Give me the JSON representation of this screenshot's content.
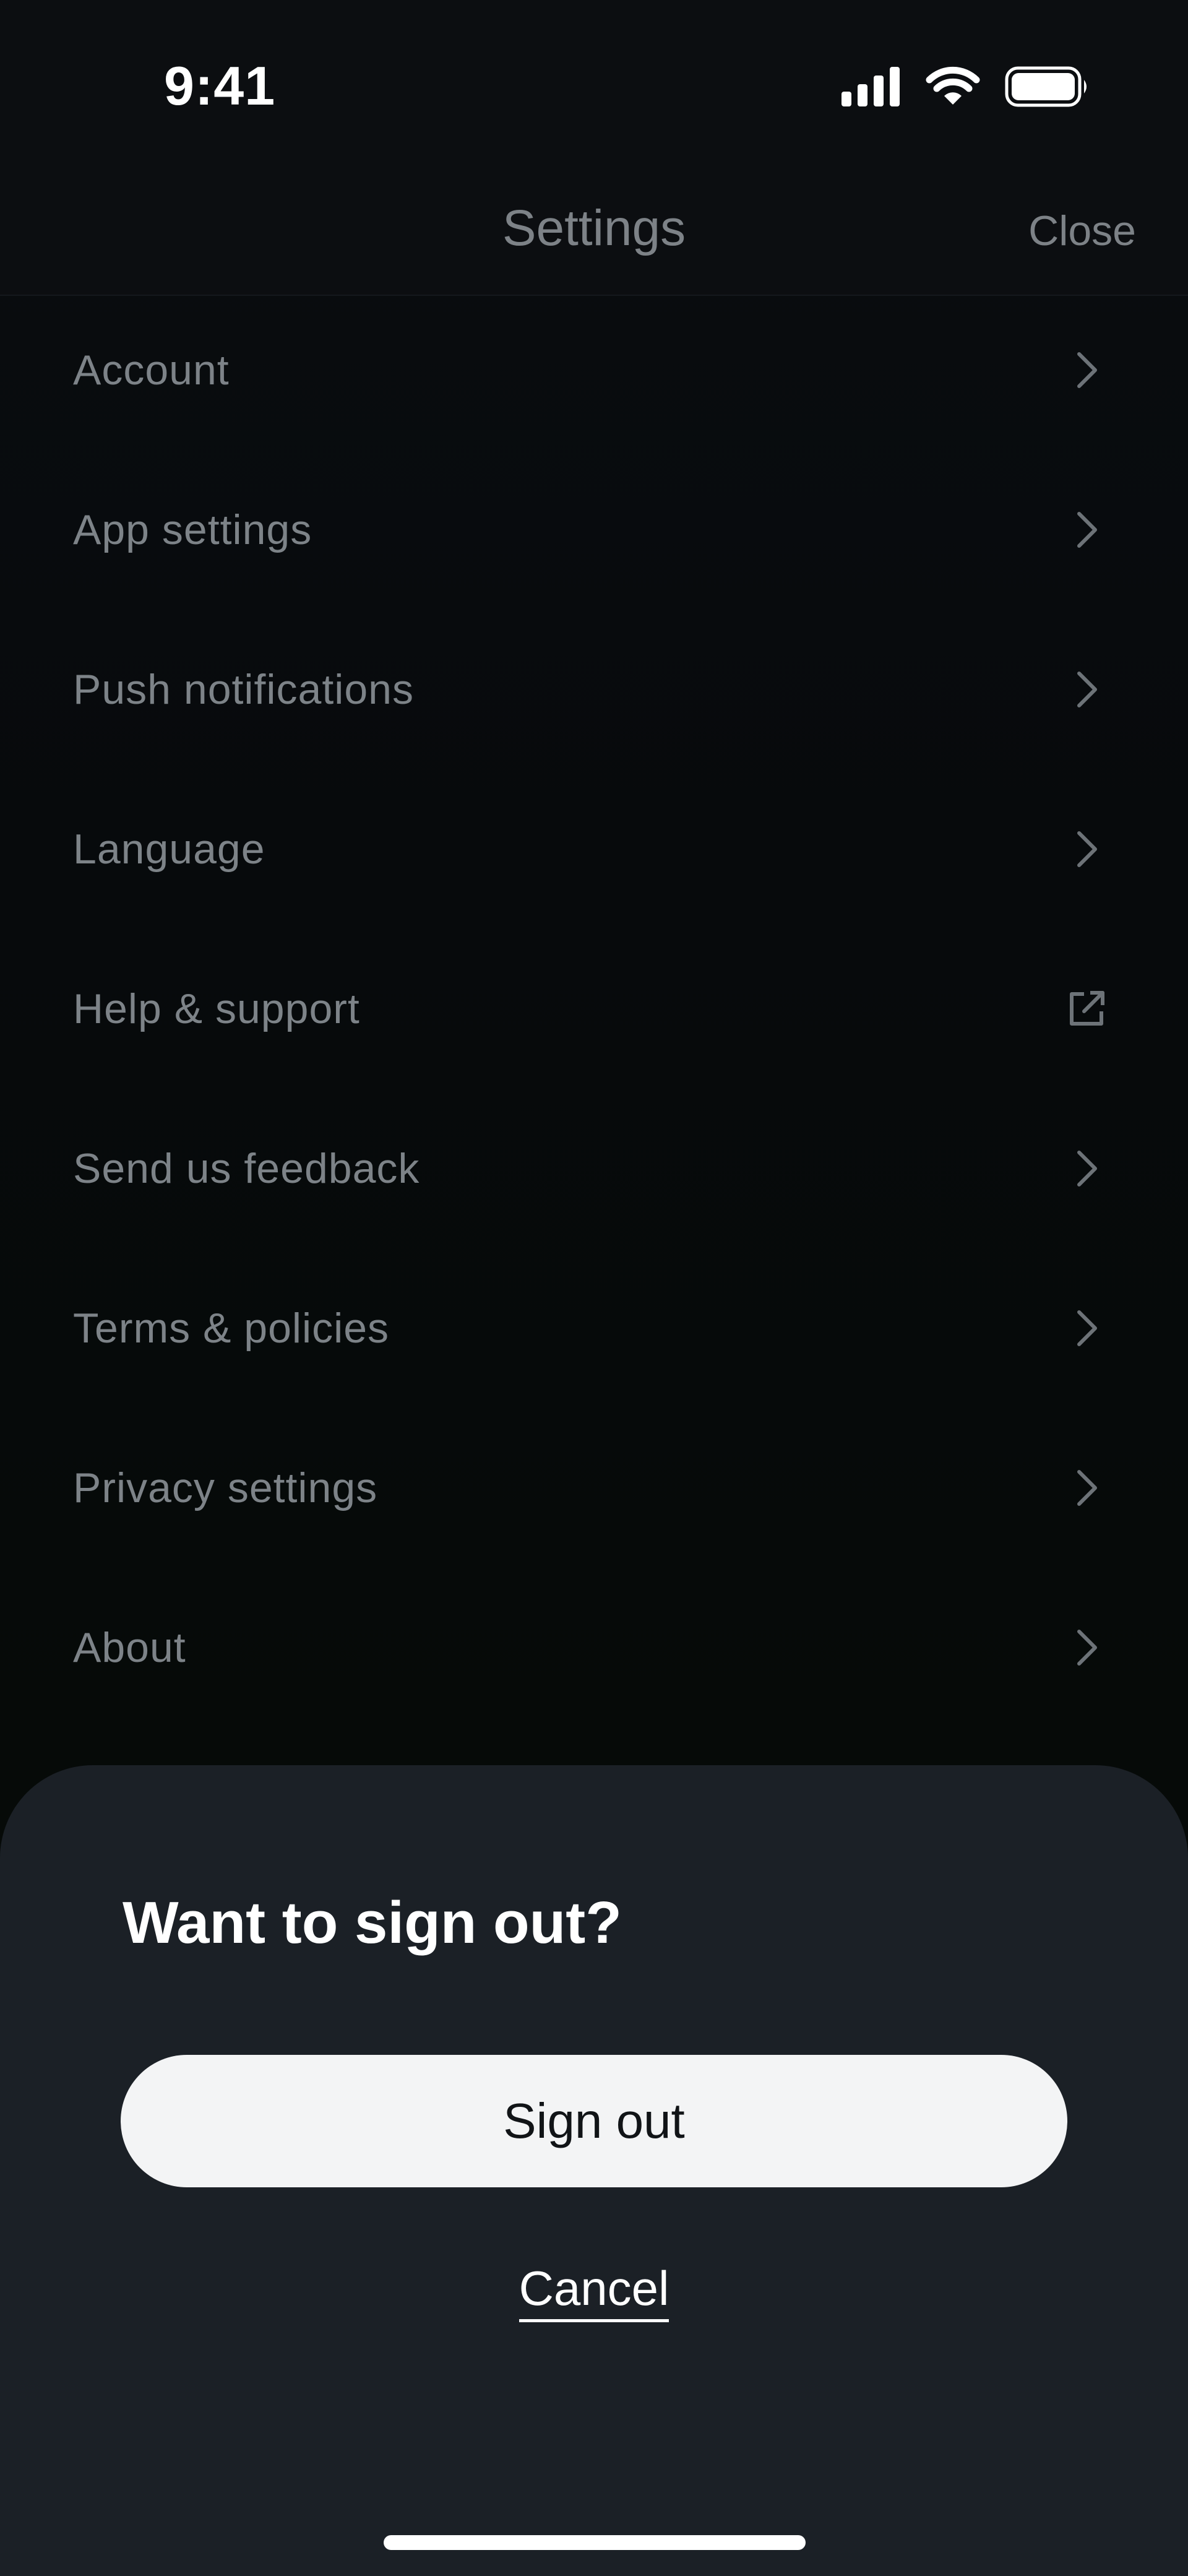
{
  "status_bar": {
    "time": "9:41",
    "icons": [
      "cellular-signal-icon",
      "wifi-icon",
      "battery-icon"
    ]
  },
  "header": {
    "title": "Settings",
    "close_label": "Close"
  },
  "settings": {
    "items": [
      {
        "label": "Account",
        "trailing_icon": "chevron-right-icon"
      },
      {
        "label": "App settings",
        "trailing_icon": "chevron-right-icon"
      },
      {
        "label": "Push notifications",
        "trailing_icon": "chevron-right-icon"
      },
      {
        "label": "Language",
        "trailing_icon": "chevron-right-icon"
      },
      {
        "label": "Help & support",
        "trailing_icon": "external-link-icon"
      },
      {
        "label": "Send us feedback",
        "trailing_icon": "chevron-right-icon"
      },
      {
        "label": "Terms & policies",
        "trailing_icon": "chevron-right-icon"
      },
      {
        "label": "Privacy settings",
        "trailing_icon": "chevron-right-icon"
      },
      {
        "label": "About",
        "trailing_icon": "chevron-right-icon"
      }
    ]
  },
  "sign_out_sheet": {
    "title": "Want to sign out?",
    "confirm_label": "Sign out",
    "cancel_label": "Cancel"
  },
  "colors": {
    "background": "#07090b",
    "sheet_background": "#1b2026",
    "muted_text": "#7d8388",
    "button_background": "#f3f4f5"
  }
}
